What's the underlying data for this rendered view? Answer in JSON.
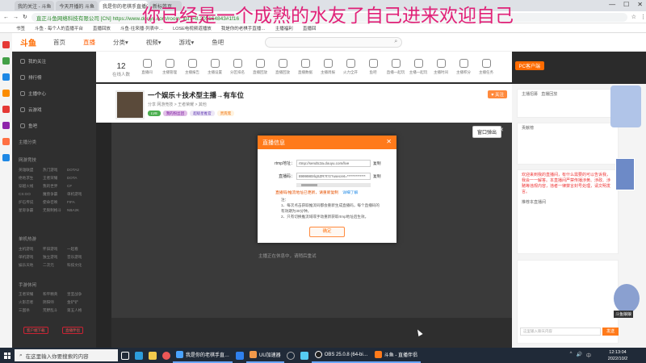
{
  "overlay_text": "你已经是一个成熟的水友了自己进来欢迎自己",
  "browser": {
    "tabs": [
      "我的关注 - 斗鱼",
      "今天开播的 斗鱼",
      "我是你的老棋手直播间…",
      "新标签页"
    ],
    "url": "直正斗鱼网络科技有限公司 [CN]  https://www.douyu.com/room_list?=8.205164843#1f16",
    "bookmarks": [
      "书签",
      "斗鱼 - 每个人的直播平台",
      "直播回放",
      "斗鱼·往来播·列表中…",
      "LOSE电视频道播放",
      "我是你的老棋手直播…",
      "主播福利",
      "直播回"
    ],
    "window_controls": [
      "—",
      "☐",
      "✕"
    ]
  },
  "header": {
    "logo": "斗鱼",
    "nav": [
      "首页",
      "直播",
      "分类▾",
      "视频▾",
      "游戏▾",
      "鱼吧"
    ],
    "active_nav": 1,
    "search_icon": "search-icon"
  },
  "sidebar": {
    "items": [
      "我的关注",
      "排行榜",
      "主播中心",
      "云游戏"
    ],
    "items2": [
      "鱼吧"
    ],
    "section1": "主播分类",
    "section2": "网游竞技",
    "grid1": [
      "英雄联盟",
      "热门游戏",
      "DOTA2",
      "绝地求生",
      "王者荣耀",
      "DOTA",
      "穿越火线",
      "我的世界",
      "CF",
      "CS:GO",
      "魔兽争霸",
      "单机游戏",
      "炉石传说",
      "使命召唤",
      "FIFA",
      "星际争霸",
      "无限制格斗",
      "NBA2K"
    ],
    "section3": "单机热游",
    "grid2": [
      "主机游戏",
      "怀旧游戏",
      "一起看",
      "单机游戏",
      "独立游戏",
      "音乐游戏",
      "娱乐天地",
      "二次元",
      "科技文化"
    ],
    "section4": "手游休闲",
    "grid3": [
      "王者荣耀",
      "和平精英",
      "皇室战争",
      "火影忍者",
      "阴阳师",
      "金铲铲",
      "三国杀",
      "荒野乱斗",
      "第五人格"
    ],
    "btn1": "客户端下载",
    "btn2": "直播伴侣"
  },
  "tools": {
    "count": "12",
    "count_label": "在线人数",
    "items": [
      "直播间",
      "主播管理",
      "主播报告",
      "主播设置",
      "分区排名",
      "直播回放",
      "直播回放",
      "直播数据",
      "主播周报",
      "火力全开",
      "鱼吧",
      "直播一起玩",
      "主播一起玩",
      "主播时间",
      "主播积分",
      "主播任务"
    ],
    "pc_btn": "PC客户端"
  },
  "streamer": {
    "title": "一个娱乐＋技术型主播→有车位",
    "meta": "分享  网游竞技 > 王者荣耀 > 其他",
    "badges": [
      "LV8",
      "我的粉丝团",
      "超级星推官",
      "贵宾席",
      "直播伴侣"
    ],
    "follow": "♥ 关注"
  },
  "video": {
    "popout_btn": "窗口弹出",
    "center_message": "主播正在休息中，请稍后重试",
    "bottom_label": "直播设置"
  },
  "dialog": {
    "title": "直播信息",
    "rtmp_label": "rtmp地址：",
    "rtmp_value": "rtmp://sendtc3a.douyu.com/live",
    "key_label": "直播码：",
    "key_value": "8999980rlqSZR?t?z?usecret=*************",
    "copy": "复制",
    "copy2": "复制",
    "warn": "直播码/推流地址已更新，请重新复制",
    "more": "详细了解",
    "notes_title": "注：",
    "note1": "1、每次点击获取推流码都会重新生成直播码，每个直播码的有效期为30分钟。",
    "note2": "2、只有切换推流域或手动重新获取rtmp地址后生效。",
    "ok": "确定"
  },
  "right_panel": {
    "tab1": "主播招募",
    "tab2": "直播回放",
    "tab3": "贡献榜",
    "notice": "欢迎来到我的直播间，有什么需要的可以告诉我，我会一一解答。本直播间严禁传播涉黄、涉政、涉赌等违规内容，违者一律禁言封号处理，请文明发言。",
    "red_text": "推荐本直播间",
    "chat_placeholder": "这里输入聊天内容",
    "send": "发送"
  },
  "anime_label": "斗鱼娘娘",
  "taskbar": {
    "search": "在这里输入你要搜索的内容",
    "apps": [
      "我是你的老棋手直…",
      "UU加速器",
      "OBS 25.0.8 (64-bi…",
      "斗鱼 - 直播伴侣"
    ],
    "time": "12:13:04",
    "date": "2022/10/2",
    "tray": [
      "^",
      "🔊",
      "中"
    ]
  },
  "colors": {
    "accent": "#ff7a1a",
    "overlay": "#e0106e"
  }
}
